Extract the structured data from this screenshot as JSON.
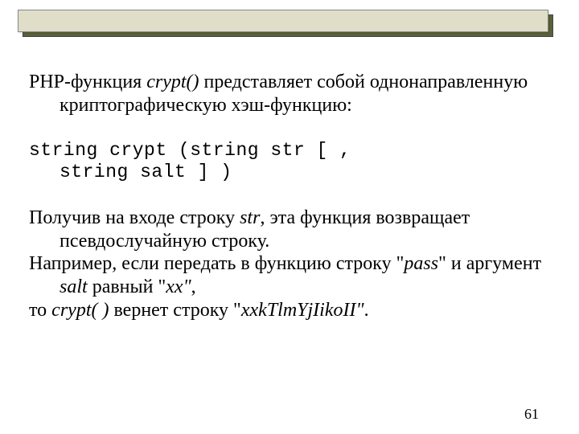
{
  "header": {},
  "content": {
    "para1_prefix": "PHP-функция ",
    "para1_func": "crypt()",
    "para1_rest": " представляет собой",
    "para1_line2": "однонаправленную криптографическую",
    "para1_line3": "хэш-функцию:",
    "code_line1": "string crypt (string  str [ ,",
    "code_line2": "string  salt ] )",
    "para2_prefix": "Получив на входе строку ",
    "para2_str": "str",
    "para2_mid": ", эта функция",
    "para2_line2": "возвращает псевдослучайную строку.",
    "para3_line1a": "Например, если передать в функцию строку",
    "para3_line2_q1": "\"",
    "para3_pass": "pass",
    "para3_line2_mid": "\" и аргумент ",
    "para3_salt": "salt",
    "para3_line2_end1": " равный \"",
    "para3_xx": "xx\"",
    "para3_line2_end2": ",",
    "para4_prefix": "то ",
    "para4_crypt": "crypt( )",
    "para4_mid": " вернет строку \"",
    "para4_result": "xxkTlmYjIikoII\"",
    "para4_end": "."
  },
  "page_number": "61"
}
